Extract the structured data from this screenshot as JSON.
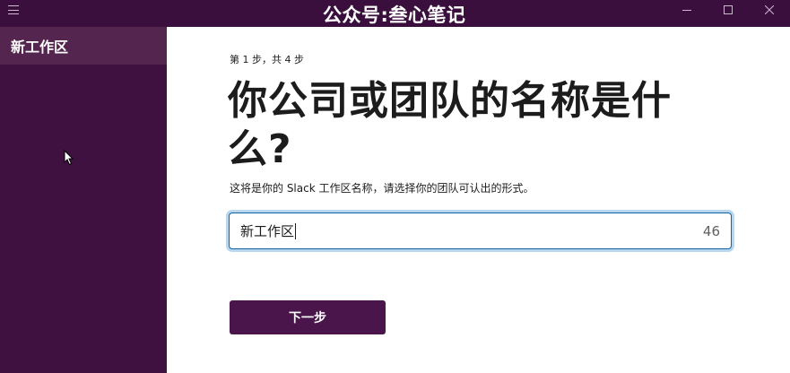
{
  "titlebar": {
    "watermark": "公众号:叁心笔记",
    "menu_icon": "hamburger-menu-icon",
    "controls": [
      "minimize-icon",
      "maximize-icon",
      "close-icon"
    ]
  },
  "sidebar": {
    "workspace_name": "新工作区"
  },
  "main": {
    "step_label": "第 1 步，共 4 步",
    "heading": "你公司或团队的名称是什么?",
    "description": "这将是你的 Slack 工作区名称，请选择你的团队可认出的形式。",
    "name_input": {
      "value": "新工作区",
      "remaining_chars": "46"
    },
    "next_button_label": "下一步"
  },
  "colors": {
    "titlebar": "#3b0f3d",
    "sidebar": "#3e1140",
    "sidebar_active": "#54264f",
    "primary_button": "#4a154b",
    "focus_ring": "#1264a3"
  }
}
